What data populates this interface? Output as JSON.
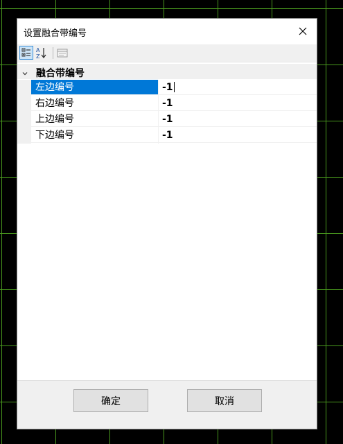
{
  "dialog": {
    "title": "设置融合带编号",
    "close_icon": "close-icon"
  },
  "toolbar": {
    "categorized_icon": "categorized-view-icon",
    "alphabetical_icon": "sort-alphabetical-icon",
    "property_pages_icon": "property-pages-icon"
  },
  "grid": {
    "category": {
      "label": "融合带编号",
      "expanded": true,
      "chevron_icon": "chevron-down-icon"
    },
    "properties": [
      {
        "name": "左边编号",
        "value": "-1",
        "selected": true,
        "editing": true
      },
      {
        "name": "右边编号",
        "value": "-1",
        "selected": false
      },
      {
        "name": "上边编号",
        "value": "-1",
        "selected": false
      },
      {
        "name": "下边编号",
        "value": "-1",
        "selected": false
      }
    ]
  },
  "footer": {
    "ok_label": "确定",
    "cancel_label": "取消"
  },
  "colors": {
    "selection": "#0078d7",
    "panel_gray": "#f0f0f0",
    "grid_line_green": "#4a9a1e",
    "background": "#000000"
  }
}
